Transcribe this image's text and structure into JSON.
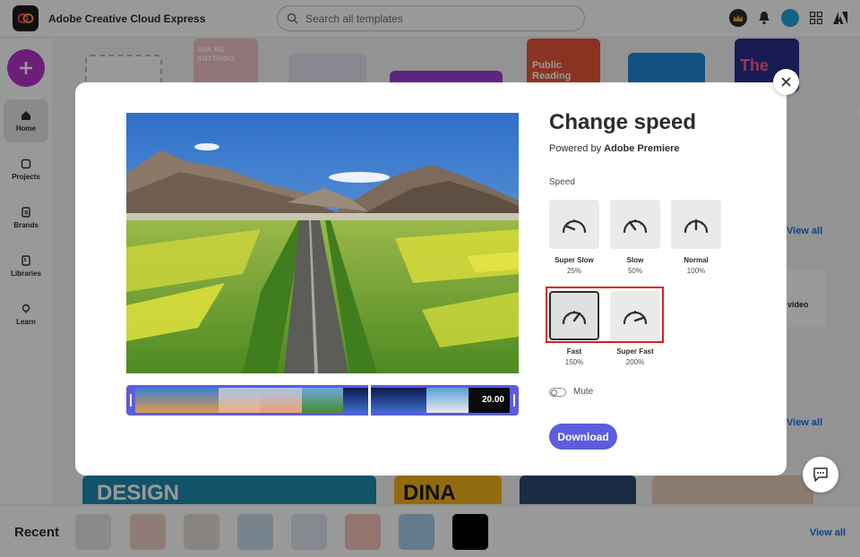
{
  "app": {
    "title": "Adobe Creative Cloud Express",
    "search_placeholder": "Search all templates"
  },
  "sidebar": {
    "items": [
      {
        "label": "Home",
        "icon": "home-icon"
      },
      {
        "label": "Projects",
        "icon": "projects-icon"
      },
      {
        "label": "Brands",
        "icon": "brands-icon"
      },
      {
        "label": "Libraries",
        "icon": "libraries-icon"
      },
      {
        "label": "Learn",
        "icon": "learn-icon"
      }
    ]
  },
  "background": {
    "view_all": "View all",
    "video_label": "video",
    "thumb_text_1": "ASK ME ANYTHING",
    "thumb_text_2": "Public Reading",
    "thumb_text_3": "The",
    "thumb_text_4": "DESIGN",
    "thumb_text_5": "DINA"
  },
  "recent": {
    "title": "Recent",
    "view_all": "View all"
  },
  "modal": {
    "title": "Change speed",
    "powered_prefix": "Powered by",
    "powered_brand": "Adobe Premiere",
    "speed_label": "Speed",
    "options": [
      {
        "name": "Super Slow",
        "pct": "25%",
        "icon": "super-slow-gauge-icon"
      },
      {
        "name": "Slow",
        "pct": "50%",
        "icon": "slow-gauge-icon"
      },
      {
        "name": "Normal",
        "pct": "100%",
        "icon": "normal-gauge-icon"
      },
      {
        "name": "Fast",
        "pct": "150%",
        "icon": "fast-gauge-icon"
      },
      {
        "name": "Super Fast",
        "pct": "200%",
        "icon": "super-fast-gauge-icon"
      }
    ],
    "selected_option": "Fast",
    "mute_label": "Mute",
    "mute_on": false,
    "download_label": "Download",
    "duration": "20.00"
  },
  "colors": {
    "accent": "#5c5ce0",
    "highlight": "#e01b1b",
    "create_button": "#b534c9"
  }
}
